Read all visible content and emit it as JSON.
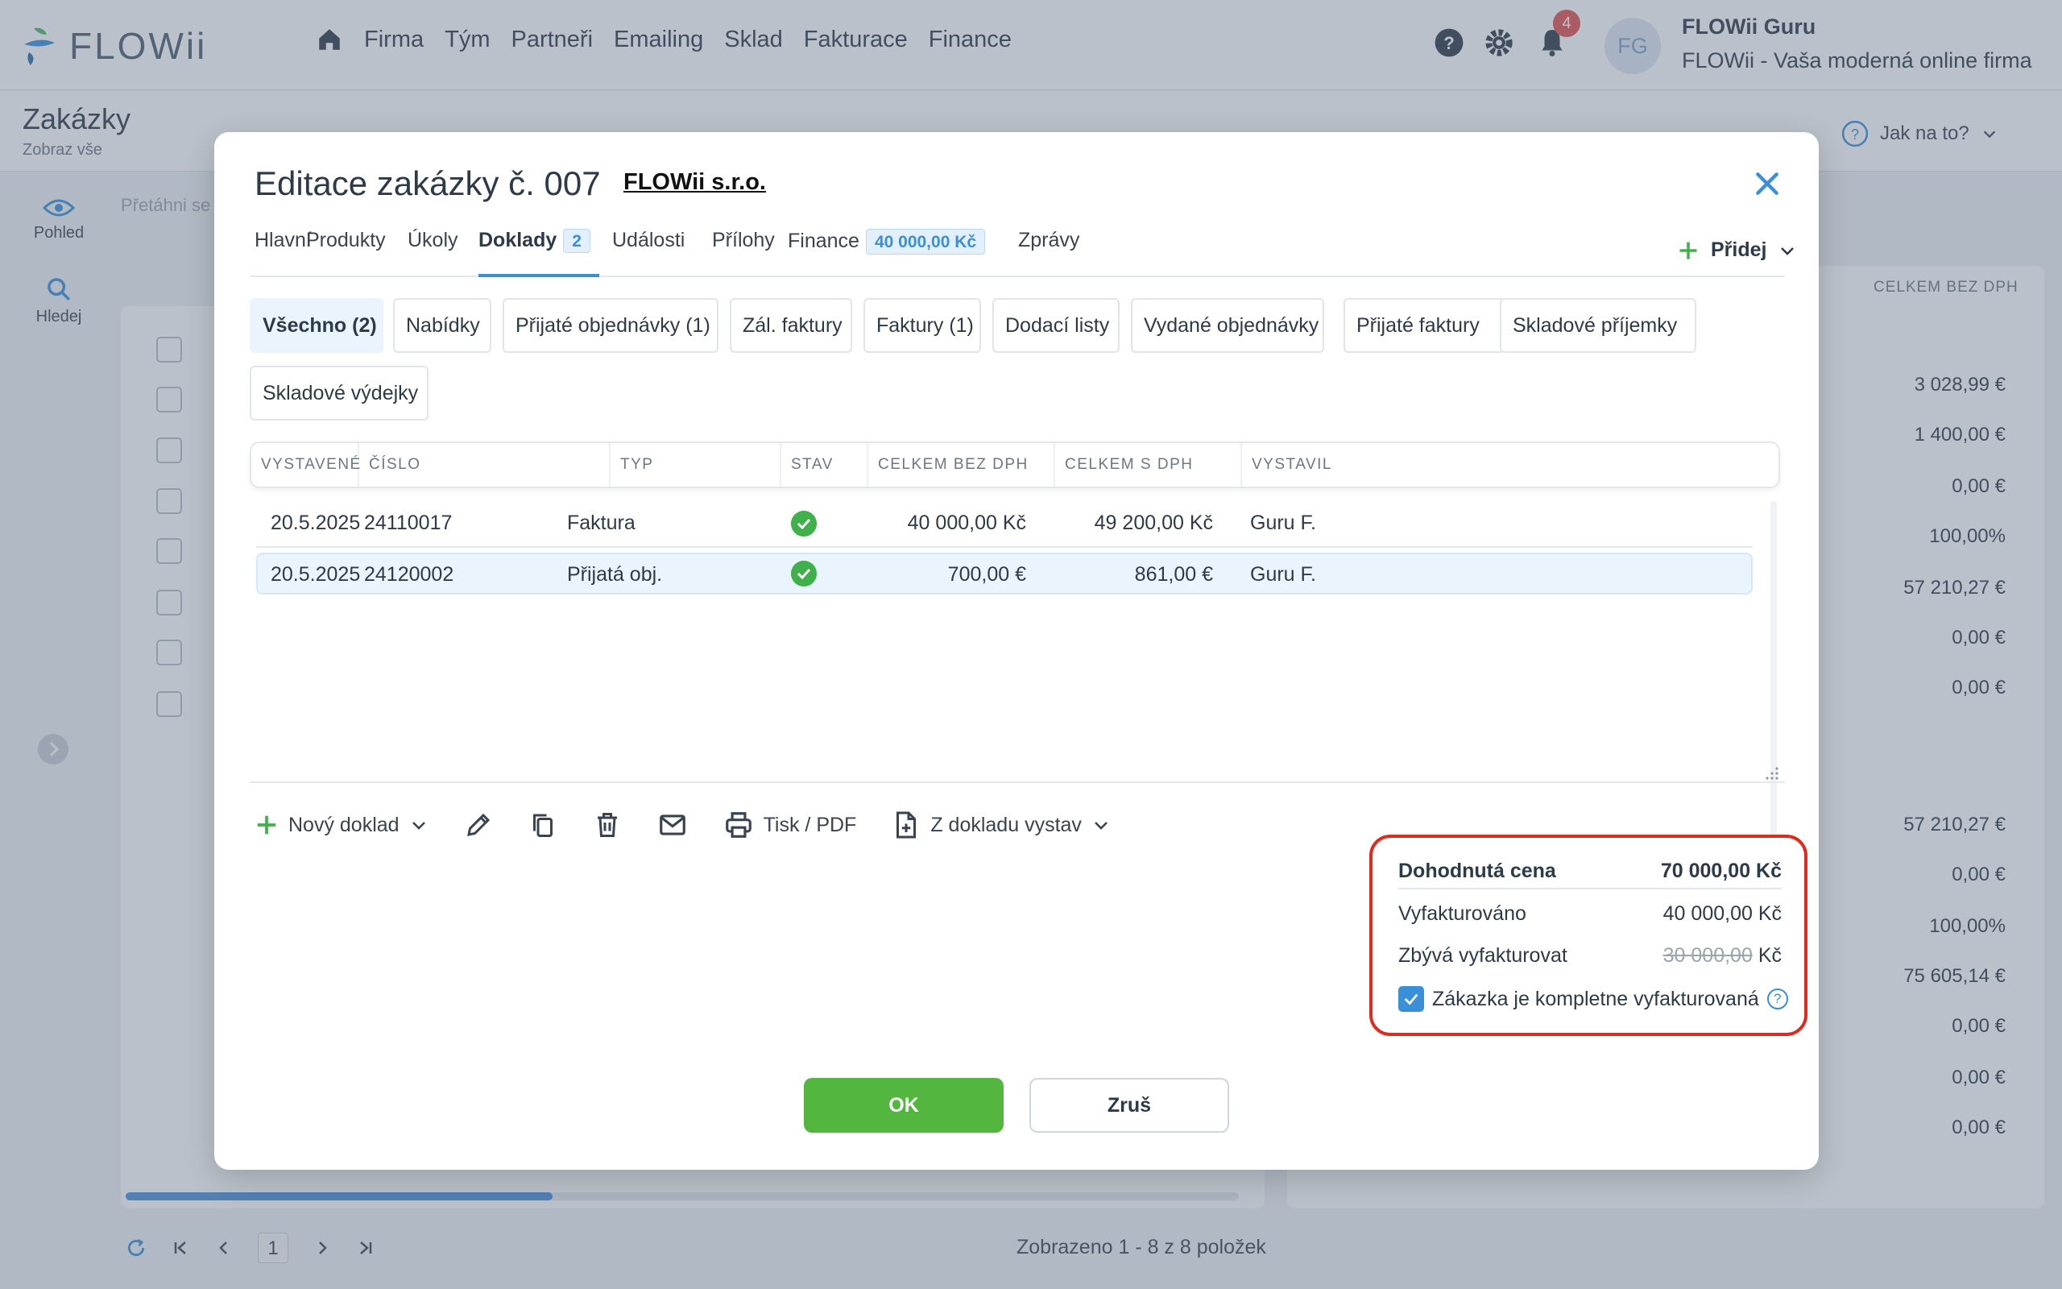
{
  "app": {
    "logo": "FLOWii",
    "nav": [
      "Firma",
      "Tým",
      "Partneři",
      "Emailing",
      "Sklad",
      "Fakturace",
      "Finance"
    ],
    "notifications_count": "4",
    "user_initials": "FG",
    "user_name": "FLOWii Guru",
    "user_company": "FLOWii - Vaša moderná online firma"
  },
  "page": {
    "title": "Zakázky",
    "subtitle": "Zobraz vše",
    "help_label": "Jak na to?",
    "rail": [
      "Pohled",
      "Hledej"
    ],
    "drag_hint": "Přetáhni se",
    "bg_column": "CELKEM BEZ DPH",
    "bg_values": [
      "3 028,99 €",
      "1 400,00 €",
      "0,00 €",
      "100,00%",
      "57 210,27 €",
      "0,00 €",
      "0,00 €",
      "57 210,27 €",
      "0,00 €",
      "100,00%",
      "75 605,14 €",
      "0,00 €",
      "0,00 €",
      "0,00 €"
    ],
    "pager_current": "1",
    "pager_info": "Zobrazeno 1 - 8 z 8 položek"
  },
  "modal": {
    "title": "Editace zakázky č. 007",
    "company": "FLOWii s.r.o.",
    "tabs": [
      {
        "label": "Hlavní"
      },
      {
        "label": "Produkty"
      },
      {
        "label": "Úkoly"
      },
      {
        "label": "Doklady",
        "count": "2"
      },
      {
        "label": "Události"
      },
      {
        "label": "Přílohy"
      },
      {
        "label": "Finance",
        "badge": "40 000,00 Kč"
      },
      {
        "label": "Zprávy"
      }
    ],
    "add_label": "Přidej",
    "filters": [
      "Všechno (2)",
      "Nabídky",
      "Přijaté objednávky (1)",
      "Zál. faktury",
      "Faktury (1)",
      "Dodací listy",
      "Vydané objednávky",
      "Přijaté faktury",
      "Skladové příjemky",
      "Skladové výdejky"
    ],
    "columns": [
      "VYSTAVENÉ",
      "ČÍSLO",
      "TYP",
      "STAV",
      "CELKEM BEZ DPH",
      "CELKEM S DPH",
      "VYSTAVIL"
    ],
    "rows": [
      {
        "date": "20.5.2025",
        "number": "24110017",
        "type": "Faktura",
        "status": "ok",
        "net": "40 000,00 Kč",
        "gross": "49 200,00 Kč",
        "by": "Guru F."
      },
      {
        "date": "20.5.2025",
        "number": "24120002",
        "type": "Přijatá obj.",
        "status": "ok",
        "net": "700,00 €",
        "gross": "861,00 €",
        "by": "Guru F."
      }
    ],
    "toolbar": {
      "new_doc": "Nový doklad",
      "print": "Tisk / PDF",
      "from_doc": "Z dokladu vystav"
    },
    "summary": {
      "agreed_label": "Dohodnutá cena",
      "agreed_value": "70 000,00 Kč",
      "invoiced_label": "Vyfakturováno",
      "invoiced_value": "40 000,00 Kč",
      "remaining_label": "Zbývá vyfakturovat",
      "remaining_value": "30 000,00",
      "remaining_unit": "Kč",
      "complete_label": "Zákazka je kompletne vyfakturovaná",
      "complete_checked": true
    },
    "ok_label": "OK",
    "cancel_label": "Zruš"
  },
  "colors": {
    "accent": "#3a8fd9",
    "ok_green": "#53b63e",
    "highlight_red": "#e02a1e"
  }
}
